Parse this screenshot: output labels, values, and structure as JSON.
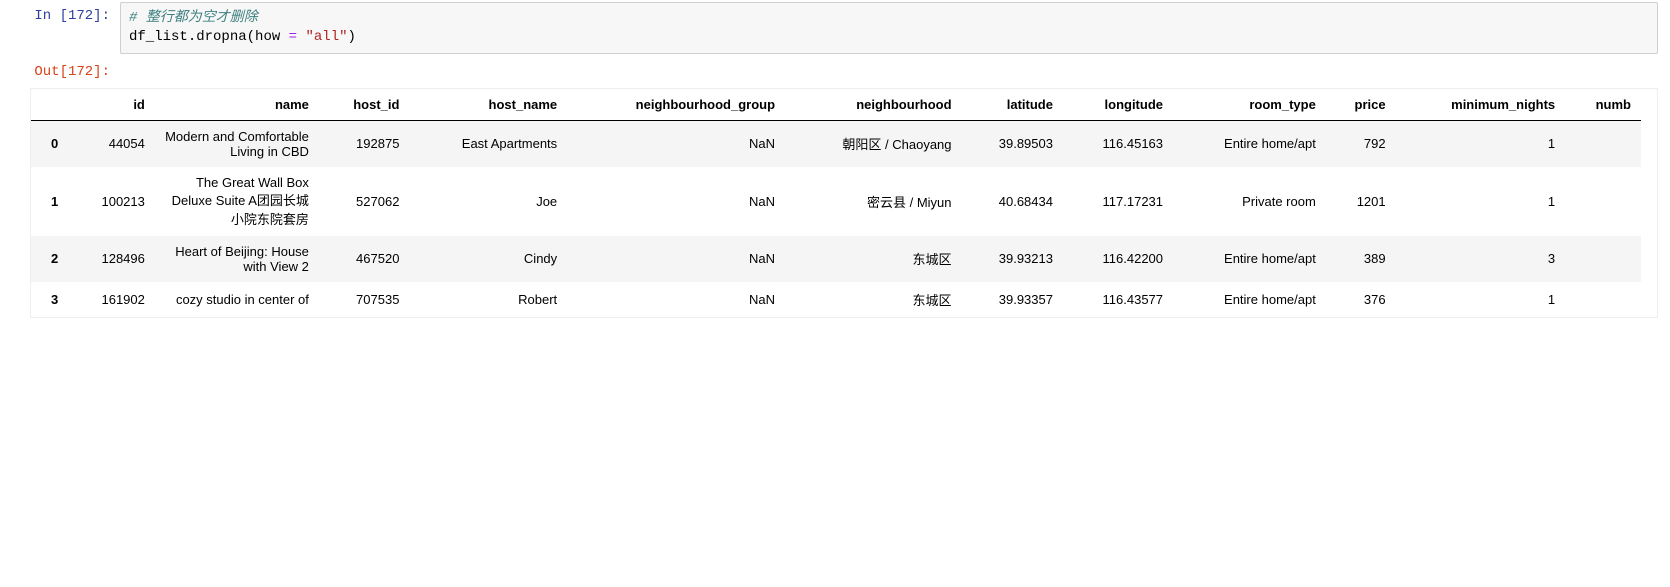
{
  "in_prompt": "In [172]:",
  "out_prompt": "Out[172]:",
  "code": {
    "comment": "# 整行都为空才删除",
    "var": "df_list",
    "dot": ".",
    "method": "dropna",
    "lparen": "(",
    "kw": "how",
    "eq": " = ",
    "str": "\"all\"",
    "rparen": ")"
  },
  "columns": [
    "",
    "id",
    "name",
    "host_id",
    "host_name",
    "neighbourhood_group",
    "neighbourhood",
    "latitude",
    "longitude",
    "room_type",
    "price",
    "minimum_nights",
    "numb"
  ],
  "rows": [
    {
      "idx": "0",
      "id": "44054",
      "name": "Modern and Comfortable Living in CBD",
      "host_id": "192875",
      "host_name": "East Apartments",
      "ng": "NaN",
      "nb": "朝阳区 / Chaoyang",
      "lat": "39.89503",
      "lon": "116.45163",
      "room": "Entire home/apt",
      "price": "792",
      "min": "1"
    },
    {
      "idx": "1",
      "id": "100213",
      "name": "The Great Wall Box Deluxe Suite A团园长城小院东院套房",
      "host_id": "527062",
      "host_name": "Joe",
      "ng": "NaN",
      "nb": "密云县 / Miyun",
      "lat": "40.68434",
      "lon": "117.17231",
      "room": "Private room",
      "price": "1201",
      "min": "1"
    },
    {
      "idx": "2",
      "id": "128496",
      "name": "Heart of Beijing: House with View 2",
      "host_id": "467520",
      "host_name": "Cindy",
      "ng": "NaN",
      "nb": "东城区",
      "lat": "39.93213",
      "lon": "116.42200",
      "room": "Entire home/apt",
      "price": "389",
      "min": "3"
    },
    {
      "idx": "3",
      "id": "161902",
      "name": "cozy studio in center of",
      "host_id": "707535",
      "host_name": "Robert",
      "ng": "NaN",
      "nb": "东城区",
      "lat": "39.93357",
      "lon": "116.43577",
      "room": "Entire home/apt",
      "price": "376",
      "min": "1"
    }
  ]
}
